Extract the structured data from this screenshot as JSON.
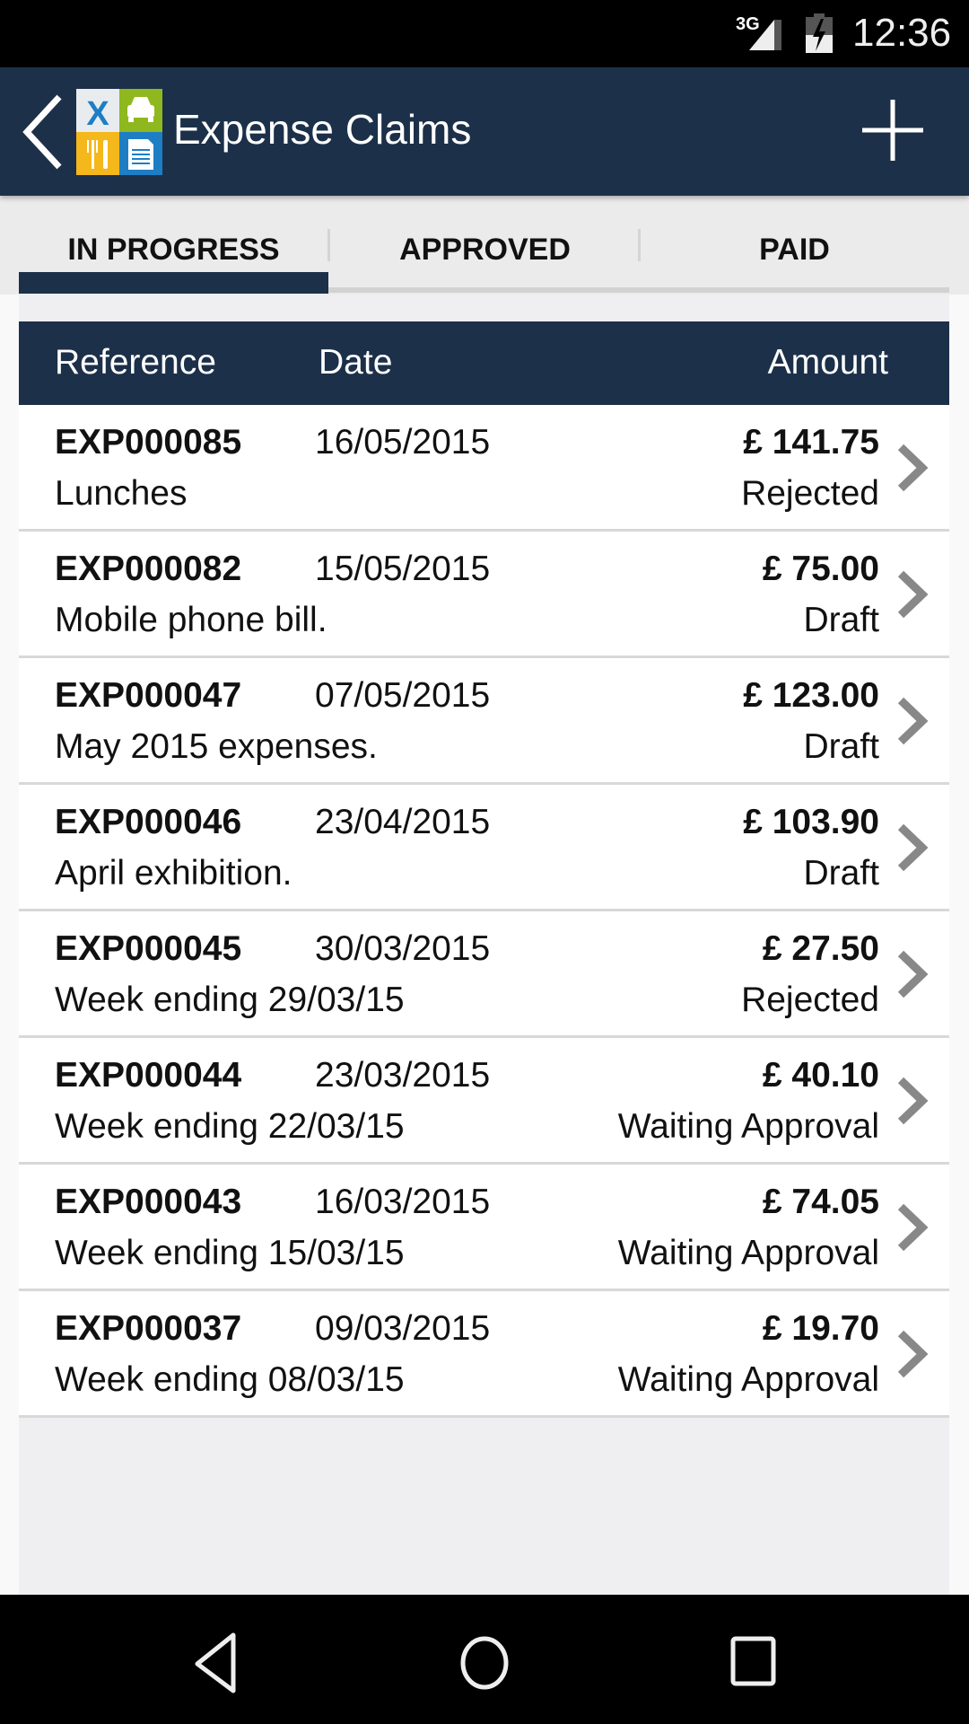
{
  "status_bar": {
    "network": "3G",
    "time": "12:36"
  },
  "app_bar": {
    "title": "Expense Claims",
    "back_icon": "chevron-left-icon",
    "add_icon": "plus-icon",
    "logo_icon": "expense-app-logo"
  },
  "tabs": [
    {
      "label": "IN PROGRESS",
      "active": true
    },
    {
      "label": "APPROVED",
      "active": false
    },
    {
      "label": "PAID",
      "active": false
    }
  ],
  "table": {
    "headers": {
      "reference": "Reference",
      "date": "Date",
      "amount": "Amount"
    },
    "rows": [
      {
        "reference": "EXP000085",
        "date": "16/05/2015",
        "description": "Lunches",
        "amount": "£ 141.75",
        "status": "Rejected"
      },
      {
        "reference": "EXP000082",
        "date": "15/05/2015",
        "description": "Mobile phone bill.",
        "amount": "£ 75.00",
        "status": "Draft"
      },
      {
        "reference": "EXP000047",
        "date": "07/05/2015",
        "description": "May 2015 expenses.",
        "amount": "£ 123.00",
        "status": "Draft"
      },
      {
        "reference": "EXP000046",
        "date": "23/04/2015",
        "description": "April exhibition.",
        "amount": "£ 103.90",
        "status": "Draft"
      },
      {
        "reference": "EXP000045",
        "date": "30/03/2015",
        "description": "Week ending 29/03/15",
        "amount": "£ 27.50",
        "status": "Rejected"
      },
      {
        "reference": "EXP000044",
        "date": "23/03/2015",
        "description": "Week ending 22/03/15",
        "amount": "£ 40.10",
        "status": "Waiting Approval"
      },
      {
        "reference": "EXP000043",
        "date": "16/03/2015",
        "description": "Week ending 15/03/15",
        "amount": "£ 74.05",
        "status": "Waiting Approval"
      },
      {
        "reference": "EXP000037",
        "date": "09/03/2015",
        "description": "Week ending 08/03/15",
        "amount": "£ 19.70",
        "status": "Waiting Approval"
      }
    ]
  },
  "colors": {
    "primary": "#1c3049",
    "chevron": "#888888",
    "tab_bg": "#ebebeb"
  }
}
